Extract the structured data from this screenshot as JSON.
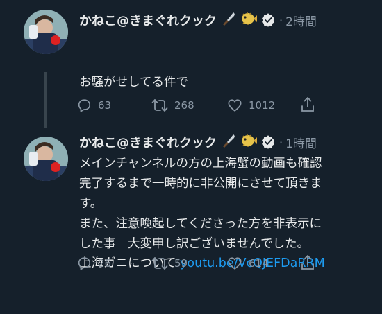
{
  "tweets": [
    {
      "author": "かねこ@きまぐれクック",
      "time": "2時間",
      "line1": "お騒がせしてる件で",
      "line2_prefix": "上海ガニについて ",
      "link": "youtu.be/VcQJEFDaRRM",
      "replies": "63",
      "retweets": "268",
      "likes": "1012"
    },
    {
      "author": "かねこ@きまぐれクック",
      "time": "1時間",
      "text": "メインチャンネルの方の上海蟹の動画も確認\n完了するまで一時的に非公開にさせて頂きま\nす。\nまた、注意喚起してくださった方を非表示に\nした事　大変申し訳ございませんでした。",
      "replies": "26",
      "retweets": "59",
      "likes": "614"
    }
  ],
  "icons": {
    "emoji1": "knife-icon",
    "emoji2": "pufferfish-icon",
    "verified": "verified-badge-icon",
    "reply": "reply-icon",
    "retweet": "retweet-icon",
    "like": "heart-icon",
    "share": "share-icon"
  },
  "colors": {
    "background": "#15202b",
    "text": "#e7e9ea",
    "secondary": "#8b98a5",
    "link": "#1d9bf0"
  }
}
